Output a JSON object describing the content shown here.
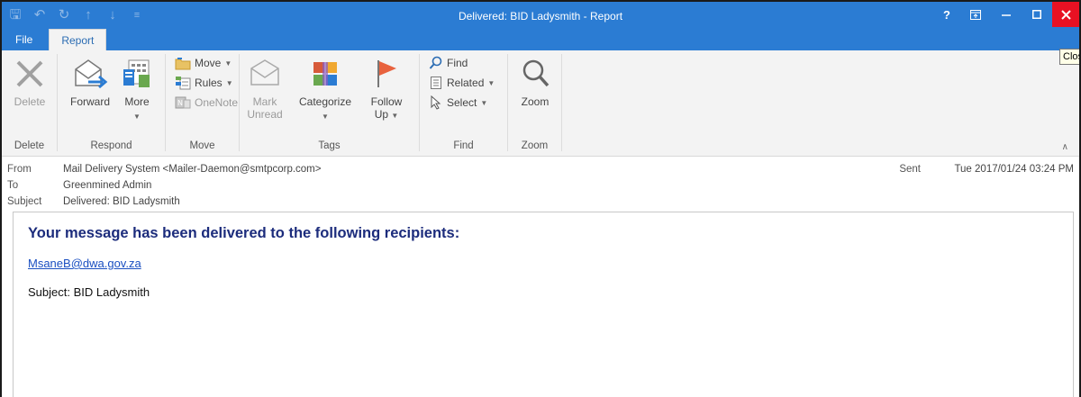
{
  "window": {
    "title": "Delivered: BID Ladysmith - Report",
    "close_tooltip": "Close",
    "help_label": "?",
    "accent": "#2b7cd3",
    "close_color": "#e81123"
  },
  "tabs": [
    {
      "label": "File",
      "active": false
    },
    {
      "label": "Report",
      "active": true
    }
  ],
  "ribbon": {
    "groups": {
      "delete": {
        "label": "Delete",
        "delete_button": "Delete"
      },
      "respond": {
        "label": "Respond",
        "forward_button": "Forward",
        "more_button": "More"
      },
      "move": {
        "label": "Move",
        "move_button": "Move",
        "rules_button": "Rules",
        "onenote_button": "OneNote"
      },
      "tags": {
        "label": "Tags",
        "mark_unread_line1": "Mark",
        "mark_unread_line2": "Unread",
        "categorize_button": "Categorize",
        "follow_up_line1": "Follow",
        "follow_up_line2": "Up"
      },
      "find": {
        "label": "Find",
        "find_button": "Find",
        "related_button": "Related",
        "select_button": "Select"
      },
      "zoom": {
        "label": "Zoom",
        "zoom_button": "Zoom"
      }
    }
  },
  "header": {
    "from_label": "From",
    "from_value": "Mail Delivery System <Mailer-Daemon@smtpcorp.com>",
    "to_label": "To",
    "to_value": "Greenmined Admin",
    "subject_label": "Subject",
    "subject_value": "Delivered: BID Ladysmith",
    "sent_label": "Sent",
    "sent_value": "Tue 2017/01/24 03:24 PM"
  },
  "body": {
    "heading": "Your message has been delivered to the following recipients:",
    "recipient": "MsaneB@dwa.gov.za",
    "subject_line": "Subject: BID Ladysmith"
  }
}
